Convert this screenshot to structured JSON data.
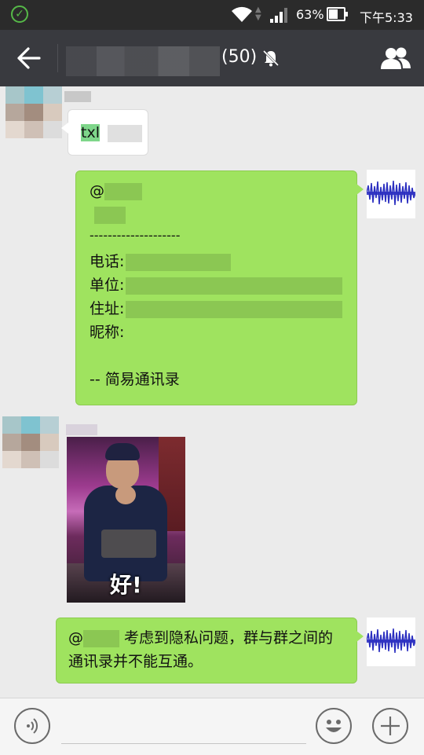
{
  "status_bar": {
    "battery_percent": "63%",
    "battery_level": 0.63,
    "time": "下午5:33"
  },
  "header": {
    "member_count": "(50)"
  },
  "messages": {
    "m1": {
      "text": "txl"
    },
    "m2": {
      "at": "@",
      "separator": "--------------------",
      "phone_label": "电话:",
      "unit_label": "单位:",
      "address_label": "住址:",
      "nickname_label": "昵称:",
      "signature": "-- 简易通讯录"
    },
    "m3": {
      "sticker_text": "好!"
    },
    "m4": {
      "at": "@",
      "line1": "考虑到隐私问题，群与群之间的",
      "line2": "通讯录并不能互通。"
    }
  },
  "icons": {
    "status_ok": "check-circle-icon",
    "wifi": "wifi-icon",
    "signal": "signal-icon",
    "battery": "battery-icon",
    "back": "back-arrow-icon",
    "mute": "bell-off-icon",
    "group": "group-members-icon",
    "voice": "voice-icon",
    "emoji": "emoji-icon",
    "plus": "plus-icon"
  },
  "colors": {
    "title_bar": "#393a3f",
    "status_bar": "#2b2b2b",
    "my_bubble": "#9fe35f",
    "chat_background": "#ebebeb"
  }
}
